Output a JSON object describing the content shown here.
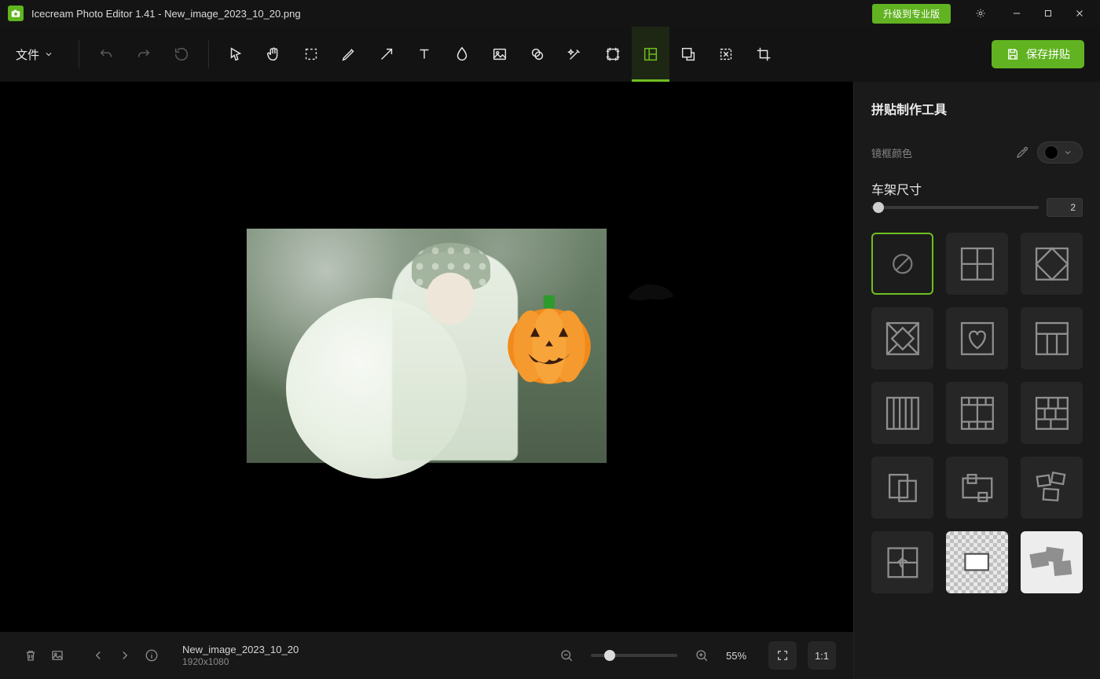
{
  "title": {
    "app": "Icecream Photo Editor 1.41",
    "sep": " - ",
    "document": "New_image_2023_10_20.png"
  },
  "titlebar": {
    "upgrade": "升级到专业版"
  },
  "toolbar": {
    "file_menu": "文件",
    "save_button": "保存拼贴"
  },
  "sidepanel": {
    "title": "拼贴制作工具",
    "frame_color_label": "镜框颜色",
    "frame_color_value": "#000000",
    "frame_size_label": "车架尺寸",
    "frame_size_value": "2",
    "selected_layout_index": 0,
    "layouts": [
      "none",
      "grid-2x2",
      "diamond",
      "diamond-corners",
      "heart",
      "t-layout",
      "columns",
      "filmstrip",
      "bricks",
      "overlap-1",
      "overlap-2",
      "scatter",
      "ribbon-grid",
      "checker-card",
      "checker-scatter"
    ]
  },
  "statusbar": {
    "filename": "New_image_2023_10_20",
    "dimensions": "1920x1080",
    "zoom_percent": "55%",
    "one_to_one": "1:1"
  }
}
